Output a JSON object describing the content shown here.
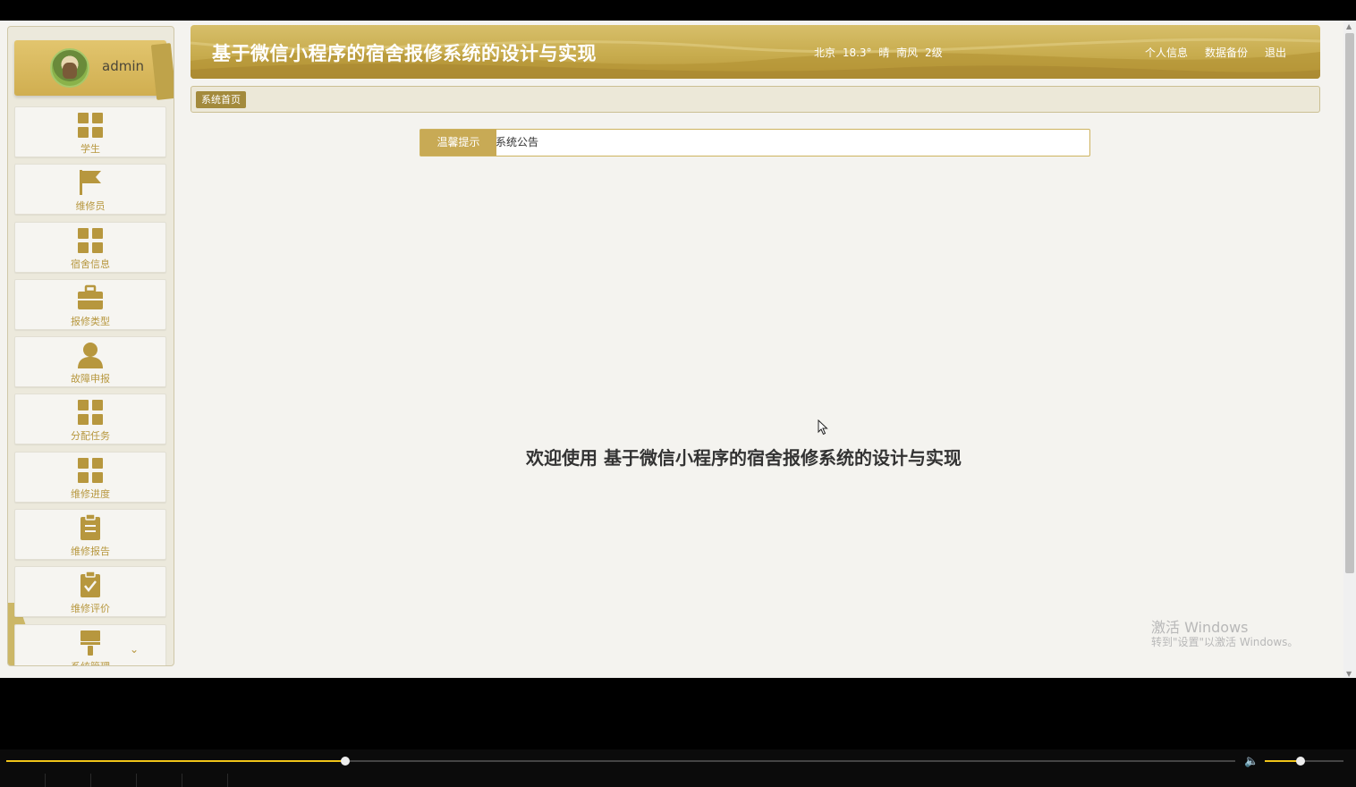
{
  "user": {
    "name": "admin"
  },
  "menu": [
    {
      "label": "学生",
      "icon": "grid-icon"
    },
    {
      "label": "维修员",
      "icon": "flag-icon"
    },
    {
      "label": "宿舍信息",
      "icon": "grid-icon"
    },
    {
      "label": "报修类型",
      "icon": "briefcase-icon"
    },
    {
      "label": "故障申报",
      "icon": "user-icon"
    },
    {
      "label": "分配任务",
      "icon": "grid-icon"
    },
    {
      "label": "维修进度",
      "icon": "grid-icon"
    },
    {
      "label": "维修报告",
      "icon": "clipboard-icon"
    },
    {
      "label": "维修评价",
      "icon": "clipboard-check-icon"
    },
    {
      "label": "系统管理",
      "icon": "paint-brush-icon"
    }
  ],
  "header": {
    "title": "基于微信小程序的宿舍报修系统的设计与实现",
    "weather": "北京 18.3° 晴 南风 2级",
    "links": [
      "个人信息",
      "数据备份",
      "退出"
    ]
  },
  "breadcrumb": {
    "home": "系统首页"
  },
  "notice": {
    "label": "温馨提示",
    "text": "系统公告"
  },
  "welcome": "欢迎使用 基于微信小程序的宿舍报修系统的设计与实现",
  "watermark": {
    "title": "激活 Windows",
    "subtitle": "转到\"设置\"以激活 Windows。"
  },
  "player": {
    "progress": 0.276,
    "volume": 0.45
  },
  "colors": {
    "accent": "#c8aa55",
    "menu_text": "#b7973e",
    "crumb": "#a38a3c",
    "seek": "#f0c419"
  }
}
